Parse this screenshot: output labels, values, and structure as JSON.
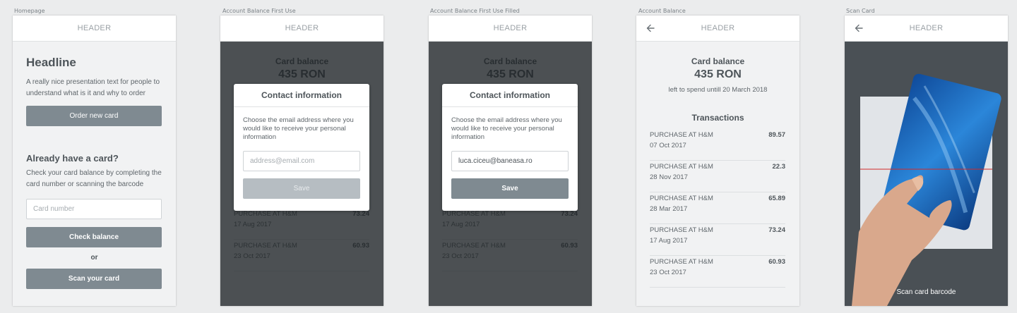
{
  "frames": [
    {
      "label": "Homepage",
      "header": "HEADER"
    },
    {
      "label": "Account Balance First Use",
      "header": "HEADER"
    },
    {
      "label": "Account Balance First Use Filled",
      "header": "HEADER"
    },
    {
      "label": "Account Balance",
      "header": "HEADER"
    },
    {
      "label": "Scan Card",
      "header": "HEADER"
    }
  ],
  "home": {
    "headline": "Headline",
    "intro": "A really nice presentation text for people to understand what is it and why to order",
    "order_button": "Order new card",
    "subhead": "Already have a card?",
    "subtext": "Check your card balance by completing the card number or scanning the barcode",
    "card_placeholder": "Card number",
    "check_button": "Check balance",
    "or_text": "or",
    "scan_button": "Scan your card"
  },
  "balance": {
    "title": "Card balance",
    "amount": "435 RON",
    "note": "left to spend untill 20 March 2018",
    "transactions_title": "Transactions",
    "transactions": [
      {
        "name": "PURCHASE AT H&M",
        "date": "07 Oct 2017",
        "amount": "89.57"
      },
      {
        "name": "PURCHASE AT H&M",
        "date": "28 Nov 2017",
        "amount": "22.3"
      },
      {
        "name": "PURCHASE AT H&M",
        "date": "28 Mar 2017",
        "amount": "65.89"
      },
      {
        "name": "PURCHASE AT H&M",
        "date": "17 Aug 2017",
        "amount": "73.24"
      },
      {
        "name": "PURCHASE AT H&M",
        "date": "23 Oct 2017",
        "amount": "60.93"
      }
    ]
  },
  "modal": {
    "title": "Contact information",
    "text": "Choose the email address where you would like to receive your personal information",
    "placeholder": "address@email.com",
    "filled_value": "luca.ciceu@baneasa.ro",
    "save": "Save"
  },
  "scan": {
    "caption": "Scan card barcode"
  },
  "colors": {
    "button": "#7f8a91",
    "button_disabled": "#b6bdc2",
    "overlay": "#1e2225",
    "card_blue": "#1f6fc4"
  }
}
